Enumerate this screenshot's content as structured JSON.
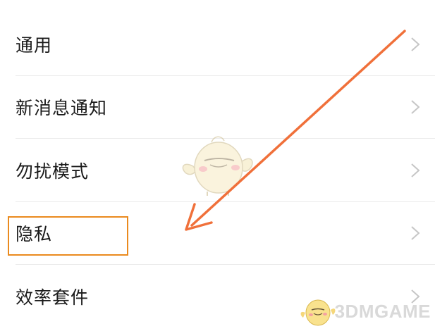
{
  "settings": {
    "items": [
      {
        "label": "通用"
      },
      {
        "label": "新消息通知"
      },
      {
        "label": "勿扰模式"
      },
      {
        "label": "隐私"
      },
      {
        "label": "效率套件"
      }
    ]
  },
  "annotation": {
    "highlight_color": "#ea8a1e",
    "arrow_color": "#f0703a",
    "highlighted_item": "隐私"
  },
  "watermark": {
    "text": "3DMGAME"
  },
  "icons": {
    "chevron": "chevron-right-icon",
    "mascot": "mascot-icon"
  }
}
